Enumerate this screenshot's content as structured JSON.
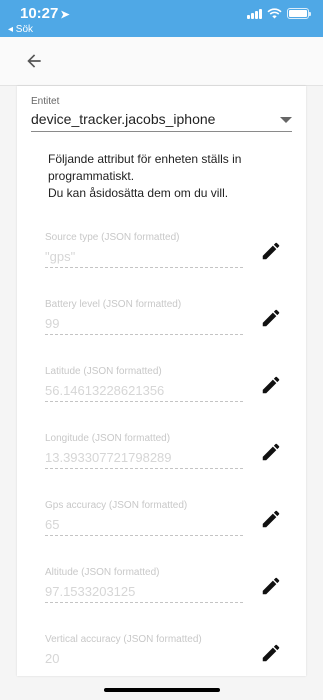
{
  "status_bar": {
    "time": "10:27",
    "location_glyph": "➤",
    "back_app": "◂ Sök",
    "icons": [
      "signal-icon",
      "wifi-icon",
      "battery-icon"
    ],
    "background": "#4fa8e6"
  },
  "app_bar": {
    "back_icon": "arrow-left-icon"
  },
  "entity": {
    "label": "Entitet",
    "value": "device_tracker.jacobs_iphone"
  },
  "info_lines": [
    "Följande attribut för enheten ställs in",
    "programmatiskt.",
    "Du kan åsidosätta dem om du vill."
  ],
  "attributes": [
    {
      "label": "Source type (JSON formatted)",
      "value": "\"gps\""
    },
    {
      "label": "Battery level (JSON formatted)",
      "value": "99"
    },
    {
      "label": "Latitude (JSON formatted)",
      "value": "56.14613228621356"
    },
    {
      "label": "Longitude (JSON formatted)",
      "value": "13.393307721798289"
    },
    {
      "label": "Gps accuracy (JSON formatted)",
      "value": "65"
    },
    {
      "label": "Altitude (JSON formatted)",
      "value": "97.1533203125"
    },
    {
      "label": "Vertical accuracy (JSON formatted)",
      "value": "20"
    }
  ]
}
